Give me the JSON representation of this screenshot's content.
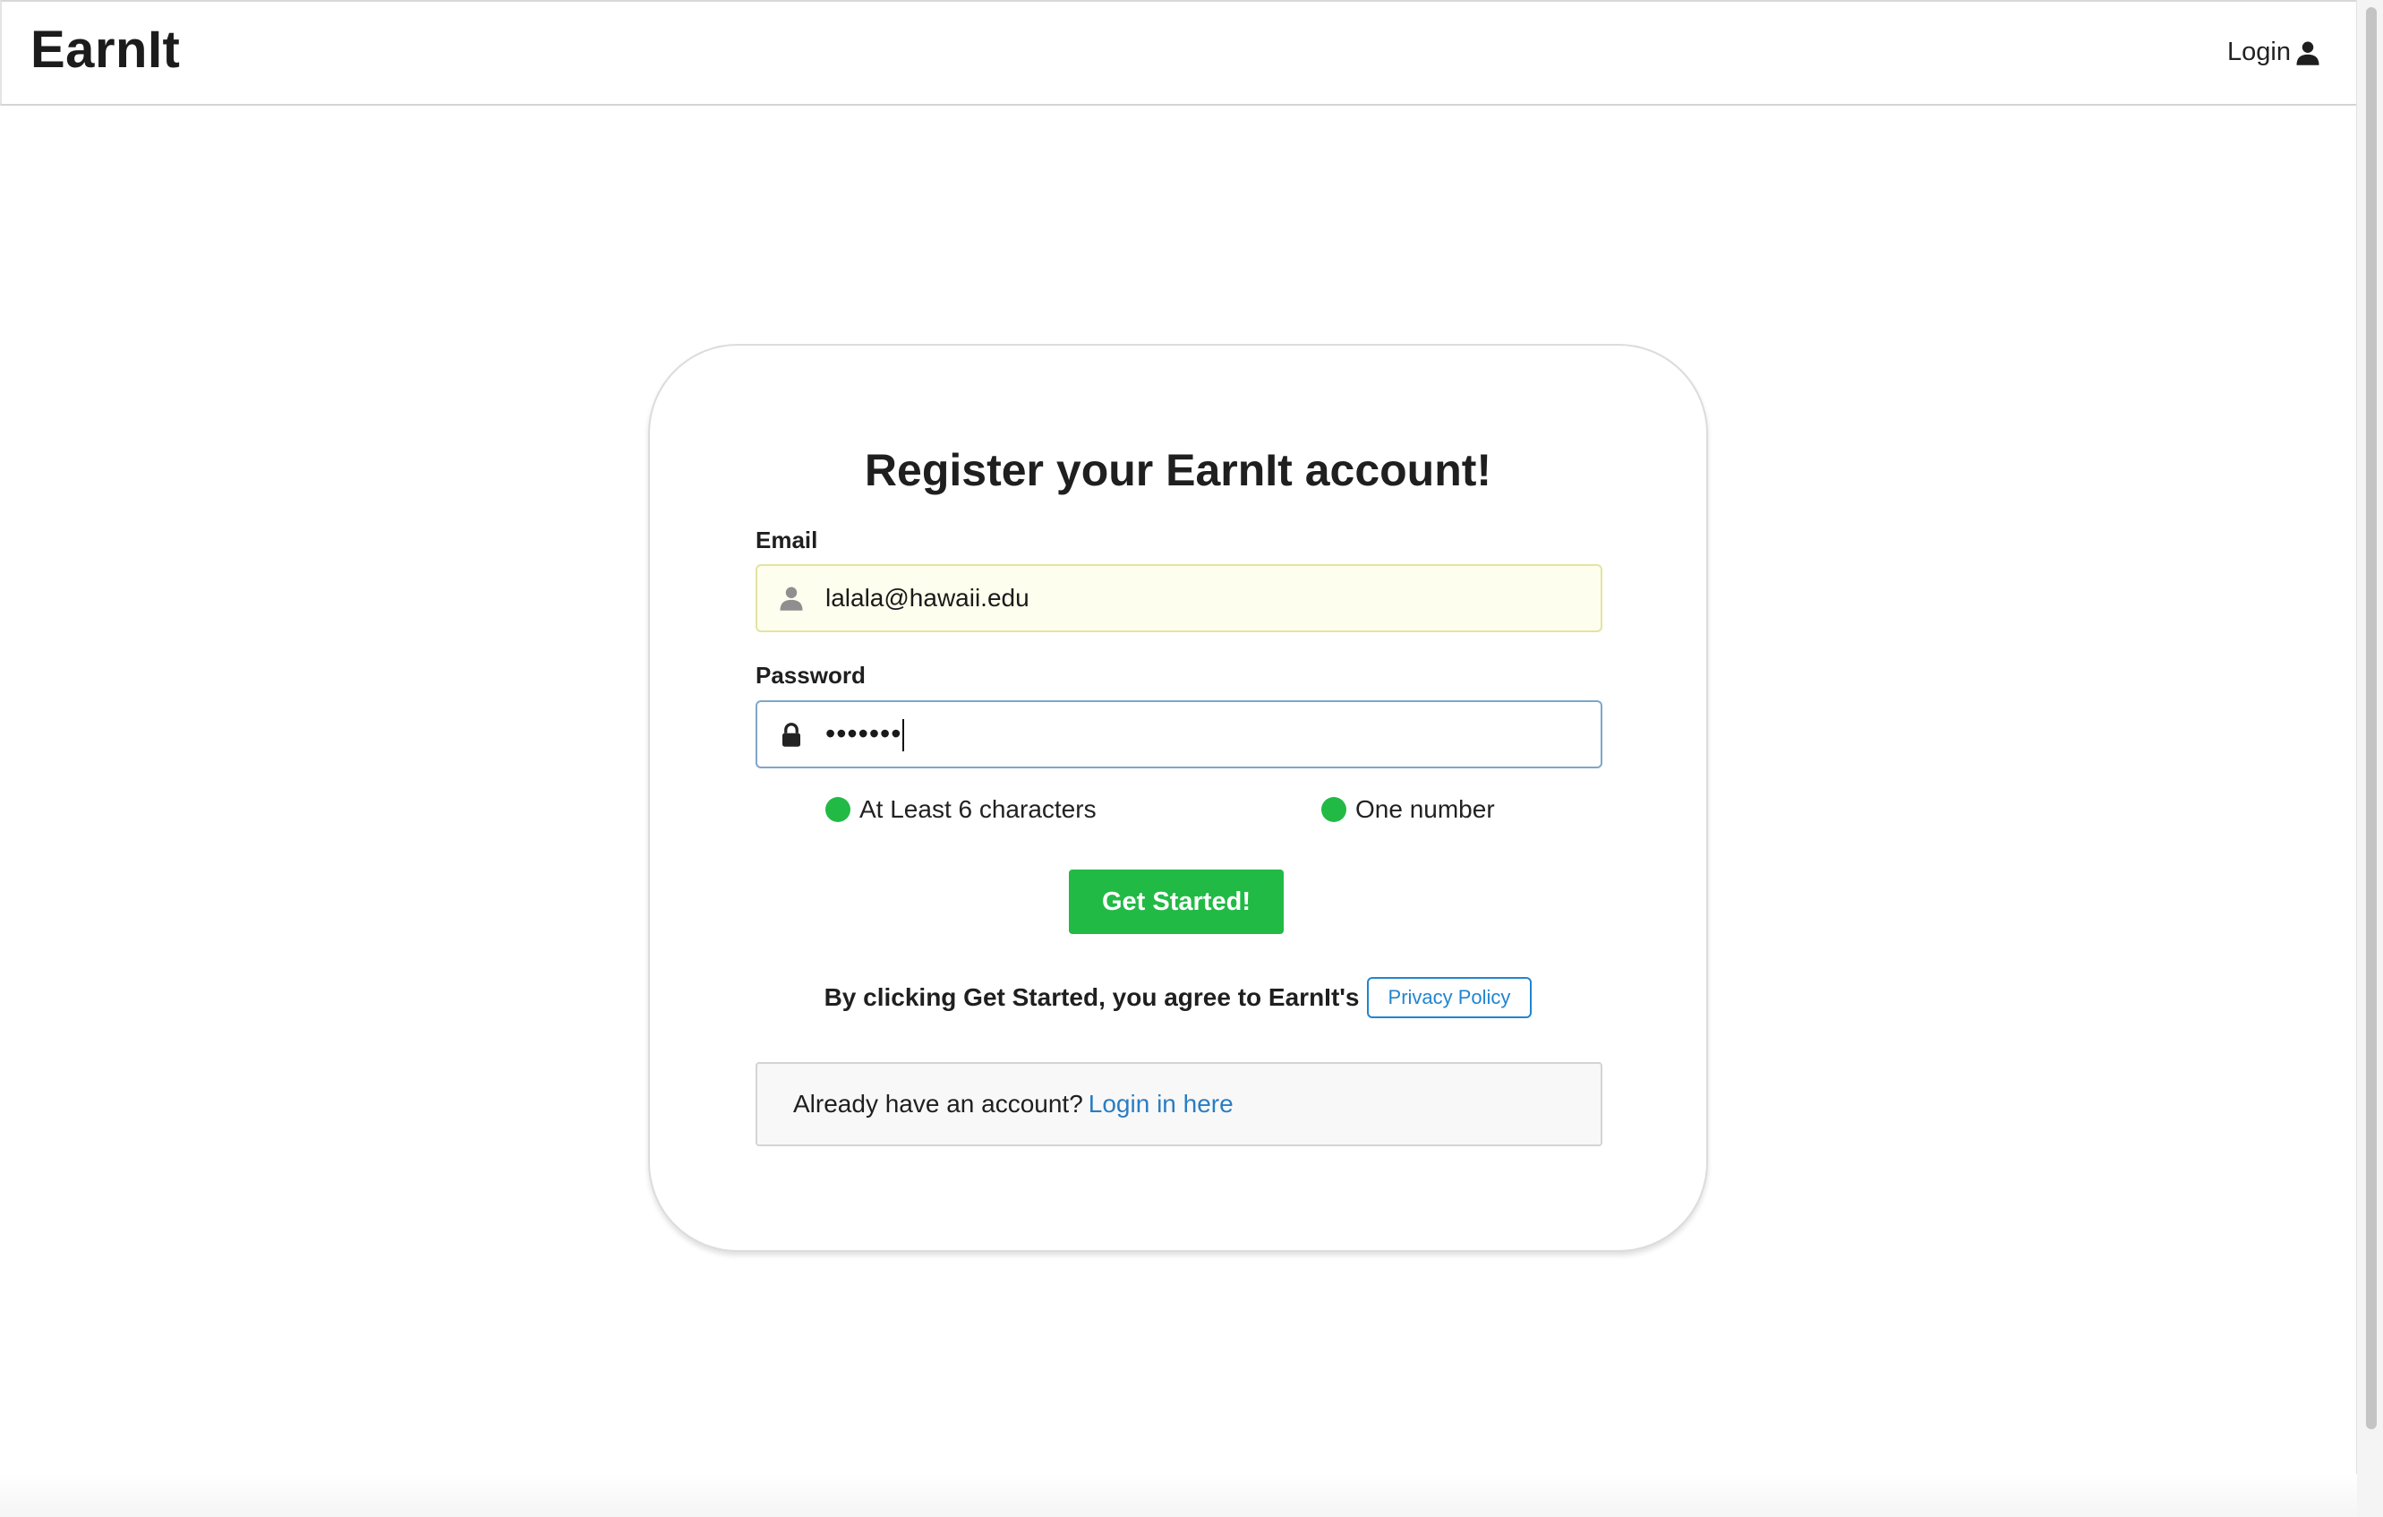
{
  "navbar": {
    "brand": "EarnIt",
    "login_label": "Login",
    "login_icon": "user-icon"
  },
  "form": {
    "title": "Register your EarnIt account!",
    "email": {
      "label": "Email",
      "value": "lalala@hawaii.edu",
      "icon": "user-icon"
    },
    "password": {
      "label": "Password",
      "masked_value": "•••••••",
      "icon": "lock-icon"
    },
    "requirements": [
      {
        "label": "At Least 6 characters",
        "status": "met"
      },
      {
        "label": "One number",
        "status": "met"
      }
    ],
    "submit_label": "Get Started!",
    "agree_text": "By clicking Get Started, you agree to EarnIt's",
    "privacy_label": "Privacy Policy",
    "already_text": "Already have an account?",
    "login_link": "Login in here"
  },
  "colors": {
    "accent_green": "#21ba45",
    "link_blue": "#2185d0",
    "autofill_bg": "#fefeee"
  }
}
